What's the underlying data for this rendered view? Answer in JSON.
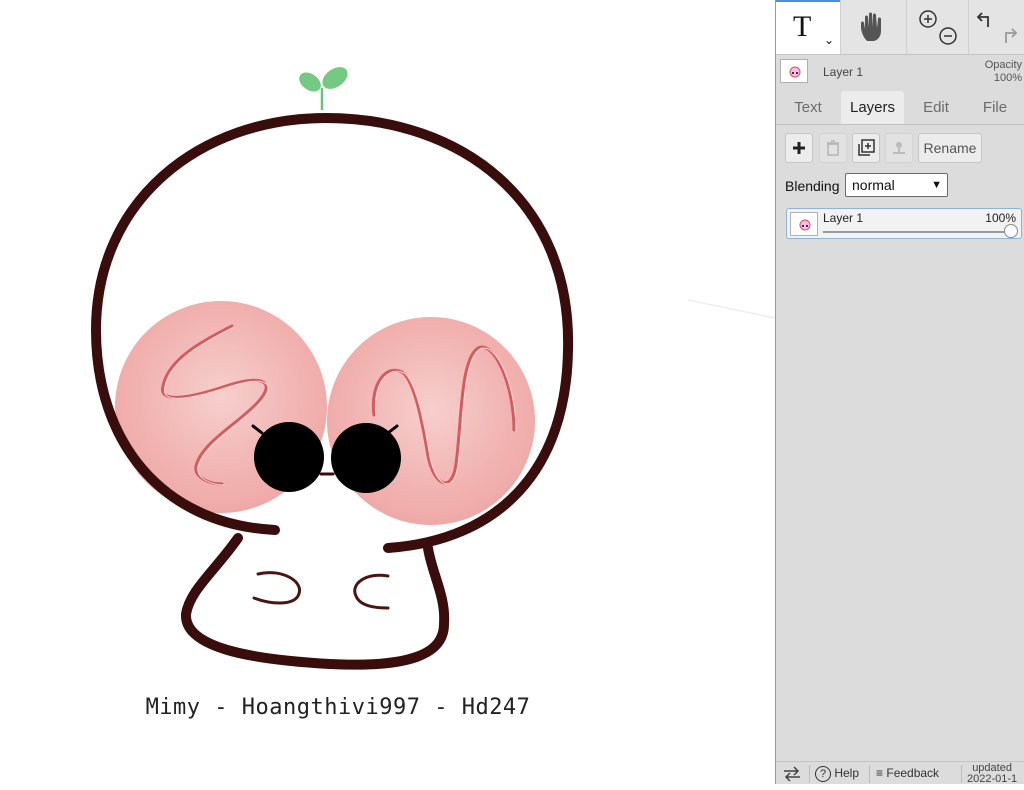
{
  "canvas": {
    "caption": "Mimy - Hoangthivi997 - Hd247",
    "colors": {
      "outline": "#3a0d0d",
      "cheek": "#f3b7b5",
      "squiggle": "#d96060",
      "sprout": "#6cc37a",
      "eye": "#000000"
    }
  },
  "panel": {
    "tools": [
      {
        "name": "text-tool",
        "label": "T"
      },
      {
        "name": "hand-icon"
      },
      {
        "name": "zoom-icons"
      },
      {
        "name": "undo-redo-icons"
      }
    ],
    "current_layer": {
      "name": "Layer 1",
      "opacity_label": "Opacity",
      "opacity_value": "100%"
    },
    "tabs": [
      {
        "label": "Text"
      },
      {
        "label": "Layers",
        "active": true
      },
      {
        "label": "Edit"
      },
      {
        "label": "File"
      }
    ],
    "layer_buttons": {
      "add": "plus-icon",
      "delete": "trash-icon",
      "duplicate": "duplicate-icon",
      "merge": "merge-down-icon",
      "rename_label": "Rename"
    },
    "blending": {
      "label": "Blending",
      "value": "normal"
    },
    "layers": [
      {
        "name": "Layer 1",
        "opacity": "100%",
        "opacity_fraction": 1.0
      }
    ],
    "footer": {
      "help": "Help",
      "feedback": "Feedback",
      "updated_line1": "updated",
      "updated_line2": "2022-01-1"
    }
  }
}
